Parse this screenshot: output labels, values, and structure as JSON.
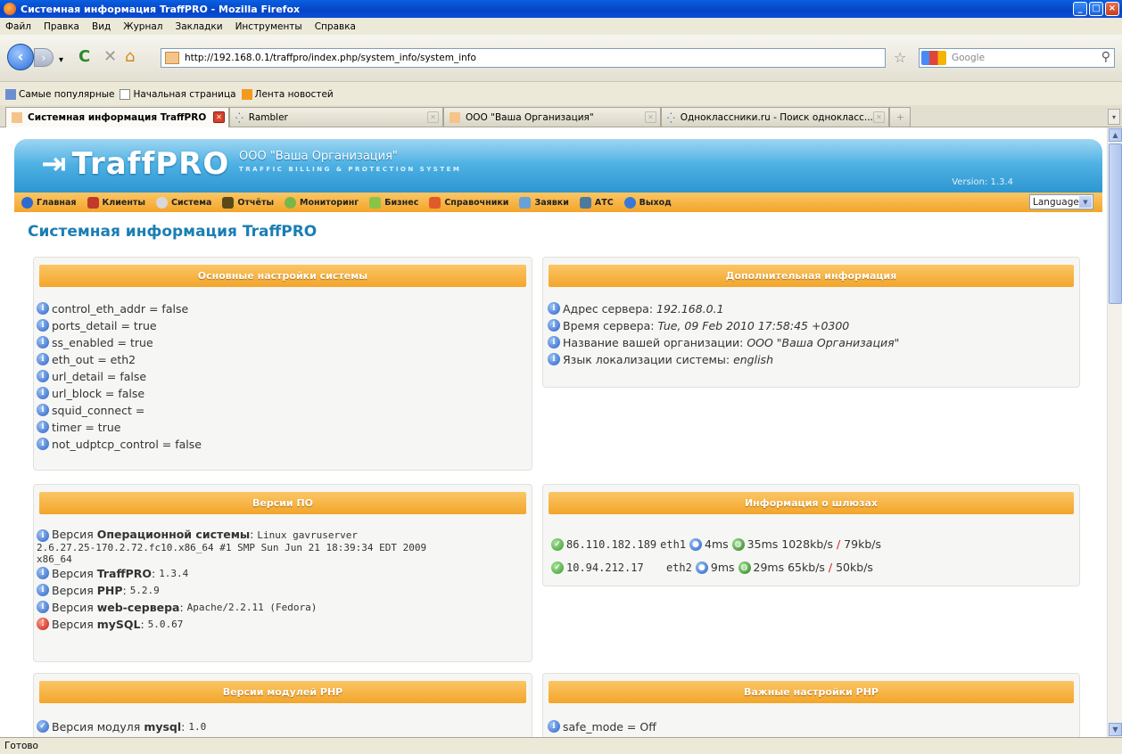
{
  "window": {
    "title": "Системная информация TraffPRO - Mozilla Firefox"
  },
  "menubar": [
    "Файл",
    "Правка",
    "Вид",
    "Журнал",
    "Закладки",
    "Инструменты",
    "Справка"
  ],
  "url": "http://192.168.0.1/traffpro/index.php/system_info/system_info",
  "search_placeholder": "Google",
  "bookmarks": [
    "Самые популярные",
    "Начальная страница",
    "Лента новостей"
  ],
  "tabs": [
    {
      "label": "Системная информация TraffPRO",
      "active": true
    },
    {
      "label": "Rambler",
      "active": false
    },
    {
      "label": "ООО \"Ваша Организация\"",
      "active": false
    },
    {
      "label": "Одноклассники.ru - Поиск однокласс...",
      "active": false
    }
  ],
  "status": "Готово",
  "site": {
    "logo": "TraffPRO",
    "org_name": "ООО \"Ваша Организация\"",
    "org_sub": "TRAFFIC BILLING & PROTECTION SYSTEM",
    "version": "Version: 1.3.4",
    "menu": [
      "Главная",
      "Клиенты",
      "Система",
      "Отчёты",
      "Мониторинг",
      "Бизнес",
      "Справочники",
      "Заявки",
      "АТС",
      "Выход"
    ],
    "language": "Language",
    "page_title": "Системная информация TraffPRO"
  },
  "panels": {
    "main_settings": {
      "title": "Основные настройки системы",
      "lines": [
        "control_eth_addr = false",
        "ports_detail = true",
        "ss_enabled = true",
        "eth_out = eth2",
        "url_detail = false",
        "url_block = false",
        "squid_connect =",
        "timer = true",
        "not_udptcp_control = false"
      ]
    },
    "extra_info": {
      "title": "Дополнительная информация",
      "lines": [
        {
          "label": "Адрес сервера:",
          "value": "192.168.0.1"
        },
        {
          "label": "Время сервера:",
          "value": "Tue, 09 Feb 2010 17:58:45 +0300"
        },
        {
          "label": "Название вашей организации:",
          "value": "ООО \"Ваша Организация\""
        },
        {
          "label": "Язык локализации системы:",
          "value": "english"
        }
      ]
    },
    "versions": {
      "title": "Версии ПО",
      "os_prefix": "Версия",
      "os_bold": "Операционной системы",
      "os_value_1": "Linux gavruserver",
      "os_value_2": "2.6.27.25-170.2.72.fc10.x86_64 #1 SMP Sun Jun 21 18:39:34 EDT 2009",
      "os_value_3": "x86_64",
      "items": [
        {
          "prefix": "Версия",
          "bold": "TraffPRO",
          "value": "1.3.4",
          "status": "info"
        },
        {
          "prefix": "Версия",
          "bold": "PHP",
          "value": "5.2.9",
          "status": "info"
        },
        {
          "prefix": "Версия",
          "bold": "web-сервера",
          "value": "Apache/2.2.11 (Fedora)",
          "status": "info"
        },
        {
          "prefix": "Версия",
          "bold": "mySQL",
          "value": "5.0.67",
          "status": "error"
        }
      ]
    },
    "gateways": {
      "title": "Информация о шлюзах",
      "rows": [
        {
          "ip": "86.110.182.189",
          "iface": "eth1",
          "ping_local": "4ms",
          "ping_ext": "35ms",
          "speed_in": "1028kb/s",
          "speed_out": "79kb/s"
        },
        {
          "ip": "10.94.212.17",
          "iface": "eth2",
          "ping_local": "9ms",
          "ping_ext": "29ms",
          "speed_in": "65kb/s",
          "speed_out": "50kb/s"
        }
      ]
    },
    "php_modules": {
      "title": "Версии модулей PHP",
      "first_prefix": "Версия модуля",
      "first_bold": "mysql",
      "first_value": "1.0"
    },
    "php_settings": {
      "title": "Важные настройки PHP",
      "first_line": "safe_mode = Off"
    }
  }
}
